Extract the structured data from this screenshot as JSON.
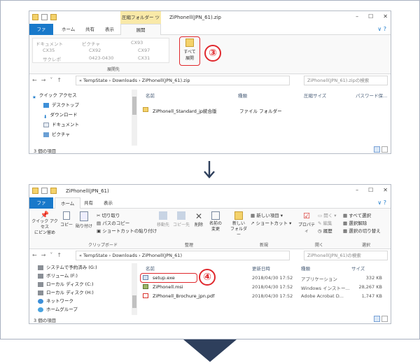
{
  "window1": {
    "title": "ZiPhonell(JPN_61).zip",
    "context_tab": "圧縮フォルダー ツール",
    "tabs": [
      "ファイル",
      "ホーム",
      "共有",
      "表示",
      "展開"
    ],
    "extract_items": [
      [
        "ドキュメント",
        "ピクチャ",
        "CX93"
      ],
      [
        "CX35",
        "CX92",
        "CX97"
      ],
      [
        "サクレポ",
        "0423-0430",
        "CX31"
      ]
    ],
    "extract_group_label": "展開先",
    "extract_all_label_1": "すべて",
    "extract_all_label_2": "展開",
    "step_badge": "③",
    "path": [
      "TempState",
      "Downloads",
      "ZiPhonell(JPN_61).zip"
    ],
    "search_placeholder": "ZiPhonell(JPN_61).zipの検索",
    "nav_items": [
      "クイック アクセス",
      "デスクトップ",
      "ダウンロード",
      "ドキュメント",
      "ピクチャ"
    ],
    "columns": [
      "名前",
      "種類",
      "圧縮サイズ",
      "パスワード保..."
    ],
    "file": {
      "name": "ZiPhonell_Standard_jp統合版",
      "type": "ファイル フォルダー"
    },
    "status": "3 個の項目"
  },
  "window2": {
    "title": "ZiPhonell(JPN_61)",
    "tabs": [
      "ファイル",
      "ホーム",
      "共有",
      "表示"
    ],
    "ribbon": {
      "quick_access": "クイック アクセス\nにピン留め",
      "copy": "コピー",
      "paste": "貼り付け",
      "cut": "切り取り",
      "copy_path": "パスのコピー",
      "paste_shortcut": "ショートカットの貼り付け",
      "clipboard": "クリップボード",
      "move_to": "移動先",
      "copy_to": "コピー先",
      "delete": "削除",
      "rename": "名前の\n変更",
      "organize": "整理",
      "new_folder": "新しい\nフォルダー",
      "new_item": "新しい項目",
      "shortcut": "ショートカット",
      "new_group": "新規",
      "properties": "プロパティ",
      "open": "開く",
      "edit": "編集",
      "history": "履歴",
      "open_group": "開く",
      "select_all": "すべて選択",
      "select_none": "選択解除",
      "invert": "選択の切り替え",
      "select_group": "選択"
    },
    "path": [
      "TempState",
      "Downloads",
      "ZiPhonell(JPN_61)"
    ],
    "search_placeholder": "ZiPhonell(JPN_61)の検索",
    "nav_items": [
      "システムで予約済み (G:)",
      "ボリューム (F:)",
      "ローカル ディスク (C:)",
      "ローカル ディスク (H:)",
      "ネットワーク",
      "ホームグループ"
    ],
    "columns": [
      "名前",
      "更新日時",
      "種類",
      "サイズ"
    ],
    "files": [
      {
        "name": "setup.exe",
        "date": "2018/04/30 17:52",
        "type": "アプリケーション",
        "size": "332 KB"
      },
      {
        "name": "ZiPhonell.msi",
        "date": "2018/04/30 17:52",
        "type": "Windows インストー...",
        "size": "28,267 KB"
      },
      {
        "name": "ZiPhonell_Brochure_jpn.pdf",
        "date": "2018/04/30 17:52",
        "type": "Adobe Acrobat D...",
        "size": "1,747 KB"
      }
    ],
    "step_badge": "④",
    "status": "3 個の項目"
  },
  "colors": {
    "accent": "#1979ca",
    "highlight": "#e0282d",
    "arrow": "#2e3f5c",
    "folder": "#f4d26b"
  }
}
